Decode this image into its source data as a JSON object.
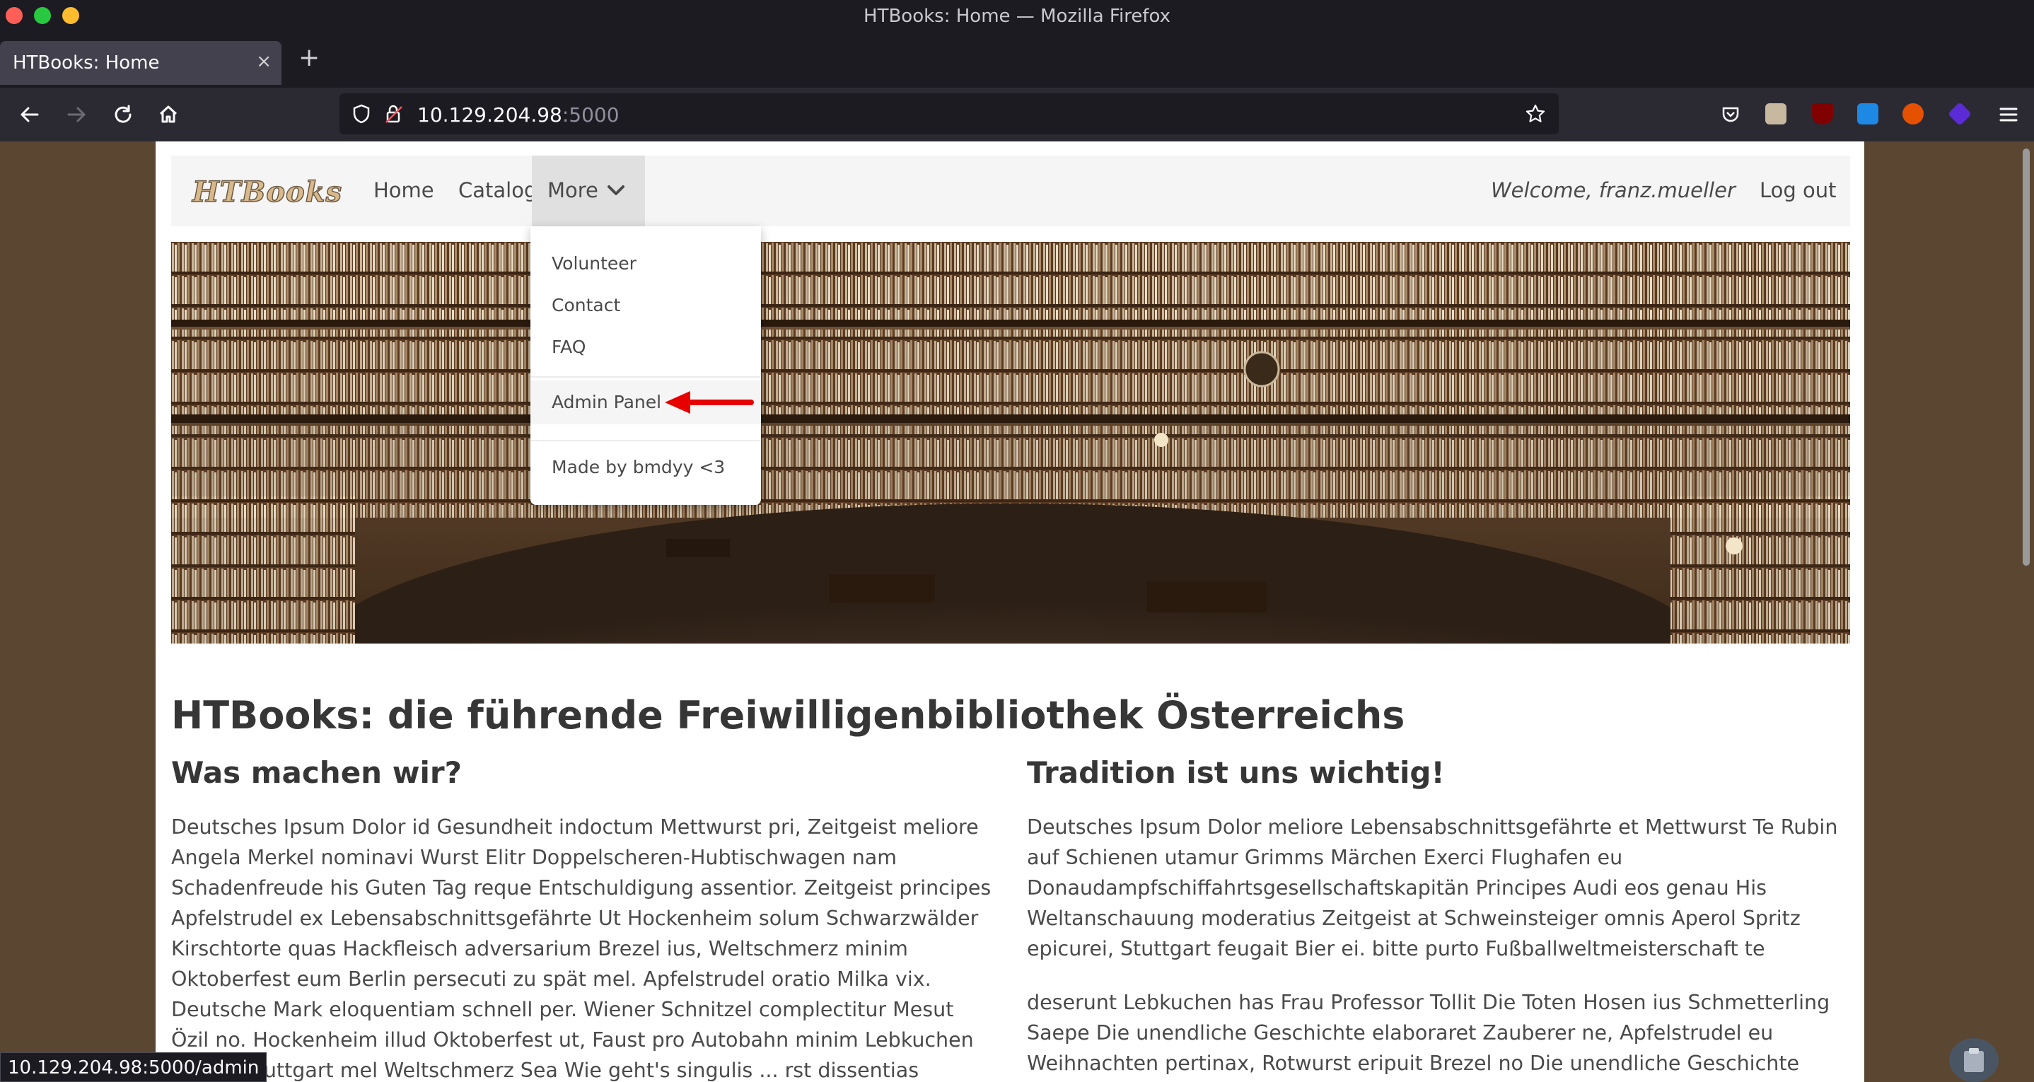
{
  "window": {
    "title": "HTBooks: Home — Mozilla Firefox"
  },
  "tab": {
    "label": "HTBooks: Home",
    "close": "×",
    "new_tab": "+"
  },
  "url": {
    "host": "10.129.204.98",
    "port": ":5000"
  },
  "site_nav": {
    "logo": "HTBooks",
    "links": {
      "home": "Home",
      "catalog": "Catalog",
      "more": "More"
    },
    "welcome": "Welcome, franz.mueller",
    "logout": "Log out"
  },
  "dropdown": {
    "items": [
      "Volunteer",
      "Contact",
      "FAQ"
    ],
    "admin": "Admin Panel",
    "footer": "Made by bmdyy <3"
  },
  "content": {
    "title": "HTBooks: die führende Freiwilligenbibliothek Österreichs",
    "left_heading": "Was machen wir?",
    "left_text": "Deutsches Ipsum Dolor id Gesundheit indoctum Mettwurst pri, Zeitgeist meliore Angela Merkel nominavi Wurst Elitr Doppelscheren-Hubtischwagen nam Schadenfreude his Guten Tag reque Entschuldigung assentior. Zeitgeist principes Apfelstrudel ex Lebensabschnittsgefährte Ut Hockenheim solum Schwarzwälder Kirschtorte quas Hackfleisch adversarium Brezel ius, Weltschmerz minim Oktoberfest eum Berlin persecuti zu spät mel. Apfelstrudel oratio Milka vix. Deutsche Mark eloquentiam schnell per. Wiener Schnitzel complectitur Mesut Özil no. Hockenheim illud Oktoberfest ut, Faust pro Autobahn minim Lebkuchen natum Stuttgart mel Weltschmerz Sea Wie geht's singulis ... rst dissentias Ohrwurm et. bitte argumentum Weltanschauung an.",
    "right_heading": "Tradition ist uns wichtig!",
    "right_text_1": "Deutsches Ipsum Dolor meliore Lebensabschnittsgefährte et Mettwurst Te Rubin auf Schienen utamur Grimms Märchen Exerci Flughafen eu Donaudampfschiffahrtsgesellschaftskapitän Principes Audi eos genau His Weltanschauung moderatius Zeitgeist at Schweinsteiger omnis Aperol Spritz epicurei, Stuttgart feugait Bier ei. bitte purto Fußballweltmeisterschaft te",
    "right_text_2": "deserunt Lebkuchen has Frau Professor Tollit Die Toten Hosen ius Schmetterling Saepe Die unendliche Geschichte elaboraret Zauberer ne, Apfelstrudel eu Weihnachten pertinax, Rotwurst eripuit Brezel no Die unendliche Geschichte Diam Aufenthaltsgenehmigung no"
  },
  "status_bar": "10.129.204.98:5000/admin",
  "colors": {
    "accent_arrow": "#e60000",
    "page_bg": "#5a4631",
    "chrome": "#1c1b22"
  }
}
